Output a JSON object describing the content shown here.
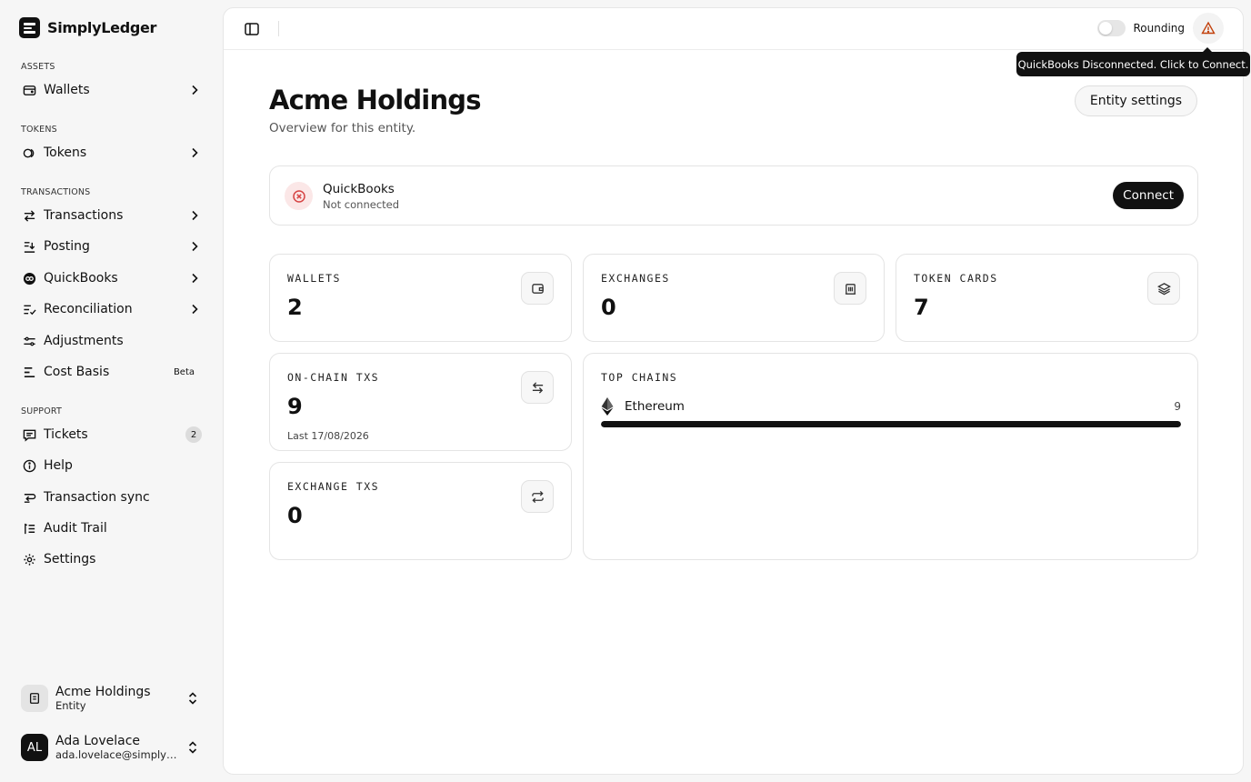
{
  "brand": {
    "name": "SimplyLedger"
  },
  "sidebar": {
    "sections": {
      "assets": "ASSETS",
      "tokens": "TOKENS",
      "transactions": "TRANSACTIONS",
      "support": "SUPPORT"
    },
    "items": [
      {
        "label": "Wallets",
        "icon": "wallet-icon"
      },
      {
        "label": "Tokens",
        "icon": "coins-icon"
      },
      {
        "label": "Transactions",
        "icon": "arrows-swap-icon"
      },
      {
        "label": "Posting",
        "icon": "posting-icon"
      },
      {
        "label": "QuickBooks",
        "icon": "quickbooks-icon"
      },
      {
        "label": "Reconciliation",
        "icon": "list-check-icon"
      },
      {
        "label": "Adjustments",
        "icon": "sliders-icon"
      },
      {
        "label": "Cost Basis",
        "icon": "cost-basis-icon",
        "badge": "Beta"
      },
      {
        "label": "Tickets",
        "icon": "ticket-icon",
        "count": "2"
      },
      {
        "label": "Help",
        "icon": "info-icon"
      },
      {
        "label": "Transaction sync",
        "icon": "sync-icon"
      },
      {
        "label": "Audit Trail",
        "icon": "audit-list-icon"
      },
      {
        "label": "Settings",
        "icon": "gear-icon"
      }
    ],
    "entity": {
      "name": "Acme Holdings",
      "type": "Entity"
    },
    "user": {
      "initials": "AL",
      "name": "Ada Lovelace",
      "email": "ada.lovelace@simplyledger.com"
    }
  },
  "topbar": {
    "rounding_label": "Rounding",
    "tooltip": "QuickBooks Disconnected. Click to Connect."
  },
  "page": {
    "title": "Acme Holdings",
    "subtitle": "Overview for this entity.",
    "entity_settings": "Entity settings"
  },
  "quickbooks": {
    "name": "QuickBooks",
    "status": "Not connected",
    "connect": "Connect"
  },
  "stats": {
    "wallets": {
      "label": "WALLETS",
      "value": "2"
    },
    "exchanges": {
      "label": "EXCHANGES",
      "value": "0"
    },
    "token_cards": {
      "label": "TOKEN CARDS",
      "value": "7"
    },
    "onchain": {
      "label": "ON-CHAIN TXS",
      "value": "9",
      "sub": "Last 17/08/2026"
    },
    "exchange_txs": {
      "label": "EXCHANGE TXS",
      "value": "0"
    }
  },
  "top_chains": {
    "label": "TOP CHAINS",
    "chains": [
      {
        "name": "Ethereum",
        "count": "9",
        "share": 1.0
      }
    ]
  },
  "colors": {
    "accent": "#111111",
    "error": "#d64545",
    "warning": "#c2410c"
  }
}
